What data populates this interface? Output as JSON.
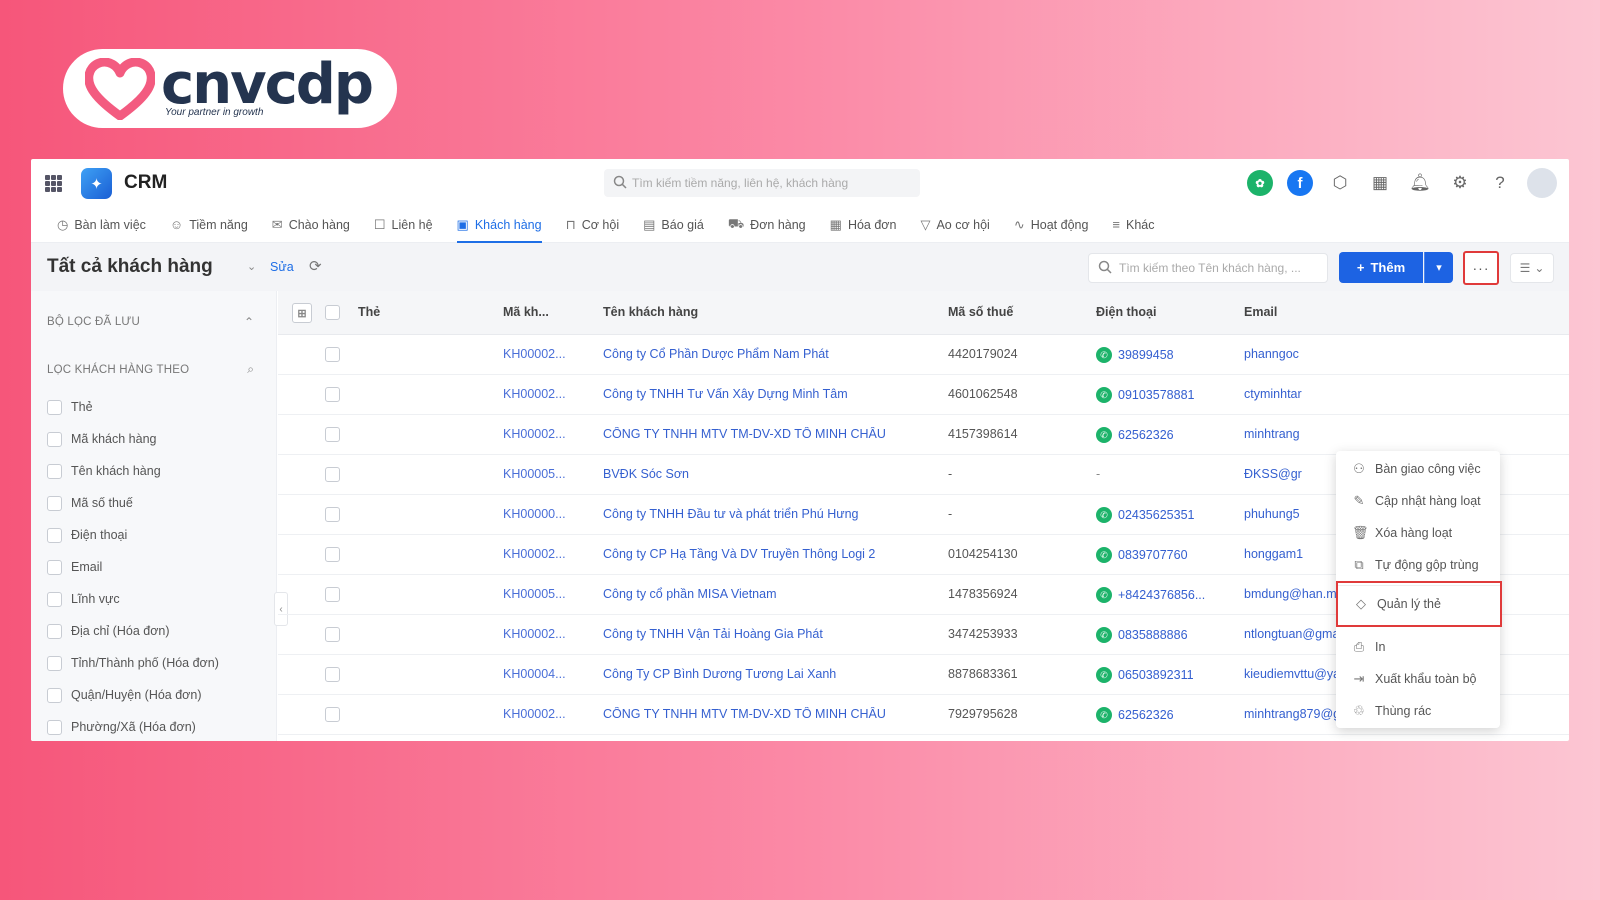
{
  "brand": {
    "name": "cnvcdp",
    "tagline": "Your partner in growth"
  },
  "app": {
    "title": "CRM",
    "search_placeholder": "Tìm kiếm tiềm năng, liên hệ, khách hàng"
  },
  "top_icons": {
    "green_label": "✿",
    "blue_label": "f"
  },
  "nav": [
    {
      "label": "Bàn làm việc",
      "icon": "◷"
    },
    {
      "label": "Tiềm năng",
      "icon": "☺"
    },
    {
      "label": "Chào hàng",
      "icon": "✉"
    },
    {
      "label": "Liên hệ",
      "icon": "☐"
    },
    {
      "label": "Khách hàng",
      "icon": "▣"
    },
    {
      "label": "Cơ hội",
      "icon": "⊓"
    },
    {
      "label": "Báo giá",
      "icon": "▤"
    },
    {
      "label": "Đơn hàng",
      "icon": "⛟"
    },
    {
      "label": "Hóa đơn",
      "icon": "▦"
    },
    {
      "label": "Ao cơ hội",
      "icon": "▽"
    },
    {
      "label": "Hoạt động",
      "icon": "∿"
    },
    {
      "label": "Khác",
      "icon": "≡"
    }
  ],
  "toolbar": {
    "title": "Tất cả khách hàng",
    "edit": "Sửa",
    "search_placeholder": "Tìm kiếm theo Tên khách hàng, ...",
    "add_label": "Thêm"
  },
  "sidebar": {
    "saved_filters": "BỘ LỌC ĐÃ LƯU",
    "filter_by": "LỌC KHÁCH HÀNG THEO",
    "filters": [
      "Thẻ",
      "Mã khách hàng",
      "Tên khách hàng",
      "Mã số thuế",
      "Điện thoại",
      "Email",
      "Lĩnh vực",
      "Địa chỉ (Hóa đơn)",
      "Tỉnh/Thành phố (Hóa đơn)",
      "Quận/Huyện (Hóa đơn)",
      "Phường/Xã (Hóa đơn)"
    ]
  },
  "table": {
    "headers": {
      "tag": "Thẻ",
      "code": "Mã kh...",
      "name": "Tên khách hàng",
      "tax": "Mã số thuế",
      "phone": "Điện thoại",
      "email": "Email"
    },
    "rows": [
      {
        "code": "KH00002...",
        "name": "Công ty Cổ Phần Dược Phẩm Nam Phát",
        "tax": "4420179024",
        "phone": "39899458",
        "email": "phanngoc",
        "tail": ""
      },
      {
        "code": "KH00002...",
        "name": "Công ty TNHH Tư Vấn Xây Dựng Minh Tâm",
        "tax": "4601062548",
        "phone": "09103578881",
        "email": "ctyminhtar",
        "tail": ""
      },
      {
        "code": "KH00002...",
        "name": "CÔNG TY TNHH MTV TM-DV-XD TÔ MINH CHÂU",
        "tax": "4157398614",
        "phone": "62562326",
        "email": "minhtrang",
        "tail": ""
      },
      {
        "code": "KH00005...",
        "name": "BVĐK Sóc Sơn",
        "tax": "-",
        "phone": "-",
        "email": "ĐKSS@gr",
        "tail": "mai"
      },
      {
        "code": "KH00000...",
        "name": "Công ty TNHH Đầu tư và phát triển Phú Hưng",
        "tax": "-",
        "phone": "02435625351",
        "email": "phuhung5",
        "tail": ""
      },
      {
        "code": "KH00002...",
        "name": "Công ty CP Hạ Tầng Và DV Truyền Thông Logi 2",
        "tax": "0104254130",
        "phone": "0839707760",
        "email": "honggam1",
        "tail": ""
      },
      {
        "code": "KH00005...",
        "name": "Công ty cổ phần MISA Vietnam",
        "tax": "1478356924",
        "phone": "+8424376856...",
        "email": "bmdung@han.misa.co...",
        "tail": "-"
      },
      {
        "code": "KH00002...",
        "name": "Công ty TNHH Vận Tải Hoàng Gia Phát",
        "tax": "3474253933",
        "phone": "0835888886",
        "email": "ntlongtuan@gmail.com",
        "tail": "-"
      },
      {
        "code": "KH00004...",
        "name": "Công Ty CP Bình Dương Tương Lai Xanh",
        "tax": "8878683361",
        "phone": "06503892311",
        "email": "kieudiemvttu@yahoo.co...",
        "tail": "-"
      },
      {
        "code": "KH00002...",
        "name": "CÔNG TY TNHH MTV TM-DV-XD TÔ MINH CHÂU",
        "tax": "7929795628",
        "phone": "62562326",
        "email": "minhtrang879@gmail.c...",
        "tail": "-"
      }
    ]
  },
  "menu": [
    {
      "label": "Bàn giao công việc",
      "icon": "⚇"
    },
    {
      "label": "Cập nhật hàng loạt",
      "icon": "✎"
    },
    {
      "label": "Xóa hàng loạt",
      "icon": "🗑"
    },
    {
      "label": "Tự động gộp trùng",
      "icon": "⧉"
    },
    {
      "label": "Quản lý thẻ",
      "icon": "◇"
    },
    {
      "label": "In",
      "icon": "⎙"
    },
    {
      "label": "Xuất khẩu toàn bộ",
      "icon": "⇥"
    },
    {
      "label": "Thùng rác",
      "icon": "♲"
    }
  ],
  "colors": {
    "primary": "#1d63e3",
    "highlight": "#e03a3a",
    "phone": "#1cb36a"
  }
}
